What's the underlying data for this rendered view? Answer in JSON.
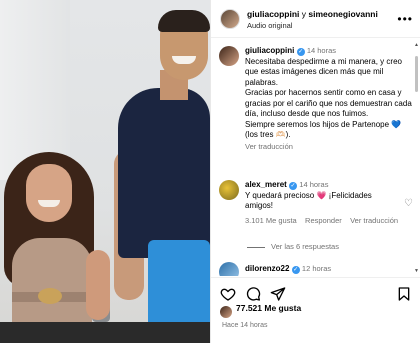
{
  "header": {
    "user1": "giuliacoppini",
    "joiner": " y ",
    "user2": "simeonegiovanni",
    "subtitle": "Audio original",
    "more_icon": "more-horizontal-icon"
  },
  "caption": {
    "username": "giuliacoppini",
    "time": "14 horas",
    "text1": "Necesitaba despedirme a mi manera, y creo que estas imágenes dicen más que mil palabras.",
    "text2": "Gracias por hacernos sentir como en casa y gracias por el cariño que nos demuestran cada día, incluso desde que nos fuimos.",
    "text3": "Siempre seremos los hijos de Partenope ",
    "text3_heart": "💙",
    "text3_end": " (los tres 🫶🏻).",
    "translate": "Ver traducción"
  },
  "comments": [
    {
      "username": "alex_meret",
      "time": "14 horas",
      "text": "Y quedará precioso ",
      "heart": "💗",
      "text_end": " ¡Felicidades amigos!",
      "likes": "3.101 Me gusta",
      "reply": "Responder",
      "translate": "Ver traducción",
      "replies": "Ver las 6 respuestas"
    },
    {
      "username": "dilorenzo22",
      "time": "12 horas"
    }
  ],
  "actions": {
    "likes_count": "77.521 Me gusta",
    "date": "Hace 14 horas"
  },
  "colors": {
    "verified": "#3897f0",
    "muted": "#737373"
  }
}
